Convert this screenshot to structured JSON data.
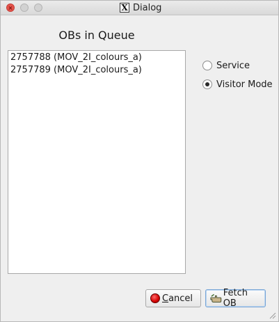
{
  "window": {
    "title": "Dialog"
  },
  "queue": {
    "heading": "OBs in Queue",
    "items": [
      "2757788 (MOV_2I_colours_a)",
      "2757789 (MOV_2I_colours_a)"
    ]
  },
  "mode": {
    "options": [
      {
        "label": "Service",
        "checked": false
      },
      {
        "label": "Visitor Mode",
        "checked": true
      }
    ]
  },
  "buttons": {
    "cancel_mnemonic": "C",
    "cancel_rest": "ancel",
    "fetch_label": "Fetch OB"
  },
  "icons": {
    "close": "close-icon",
    "minimize": "minimize-icon",
    "maximize": "maximize-icon",
    "app": "x11-logo-icon",
    "cancel": "stop-icon",
    "fetch": "hand-pointer-icon",
    "grip": "resize-grip-icon"
  },
  "colors": {
    "close_button": "#e5534b",
    "cancel_icon": "#d40000",
    "default_button_border": "#7aa6d6"
  }
}
